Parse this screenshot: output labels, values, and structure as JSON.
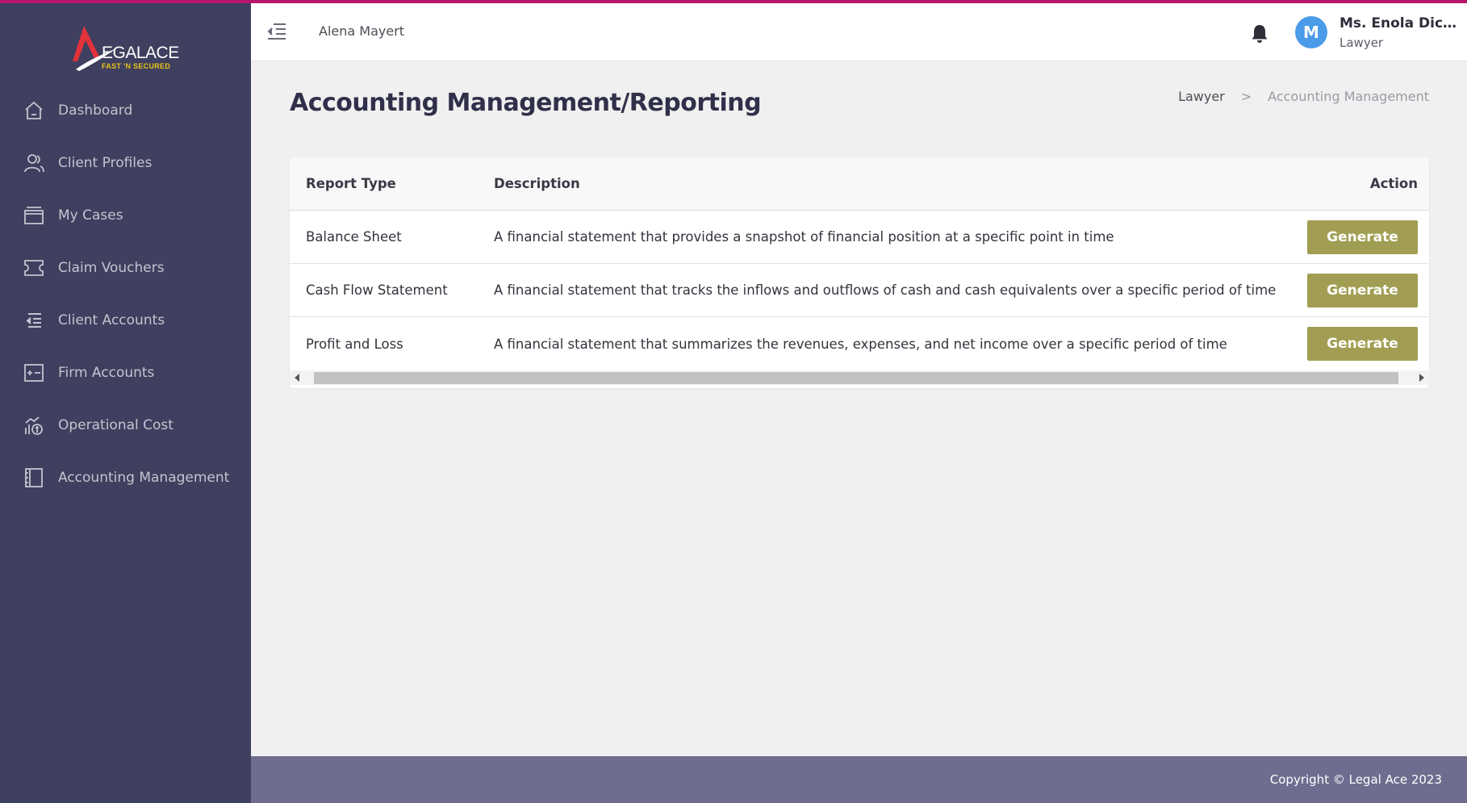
{
  "brand": {
    "logo_text": "EGALACE",
    "tagline": "FAST 'N SECURED",
    "accent_color": "#b8166e",
    "button_color": "#a19e53",
    "sidebar_color": "#3f3f5f"
  },
  "sidebar": {
    "items": [
      {
        "label": "Dashboard",
        "icon": "home-icon"
      },
      {
        "label": "Client Profiles",
        "icon": "users-icon"
      },
      {
        "label": "My Cases",
        "icon": "folder-icon"
      },
      {
        "label": "Claim Vouchers",
        "icon": "ticket-icon"
      },
      {
        "label": "Client Accounts",
        "icon": "indent-list-icon"
      },
      {
        "label": "Firm Accounts",
        "icon": "plus-minus-box-icon"
      },
      {
        "label": "Operational Cost",
        "icon": "cost-chart-icon"
      },
      {
        "label": "Accounting Management",
        "icon": "notebook-icon"
      }
    ]
  },
  "topbar": {
    "username": "Alena Mayert",
    "profile": {
      "avatar_letter": "M",
      "name": "Ms. Enola Dicki...",
      "role": "Lawyer"
    }
  },
  "page": {
    "title": "Accounting Management/Reporting",
    "breadcrumb": {
      "home": "Lawyer",
      "separator": ">",
      "current": "Accounting Management"
    }
  },
  "table": {
    "headers": {
      "type": "Report Type",
      "description": "Description",
      "action": "Action"
    },
    "rows": [
      {
        "type": "Balance Sheet",
        "description": "A financial statement that provides a snapshot of financial position at a specific point in time",
        "action": "Generate"
      },
      {
        "type": "Cash Flow Statement",
        "description": "A financial statement that tracks the inflows and outflows of cash and cash equivalents over a specific period of time",
        "action": "Generate"
      },
      {
        "type": "Profit and Loss",
        "description": "A financial statement that summarizes the revenues, expenses, and net income over a specific period of time",
        "action": "Generate"
      }
    ]
  },
  "footer": {
    "copyright": "Copyright © Legal Ace 2023"
  }
}
